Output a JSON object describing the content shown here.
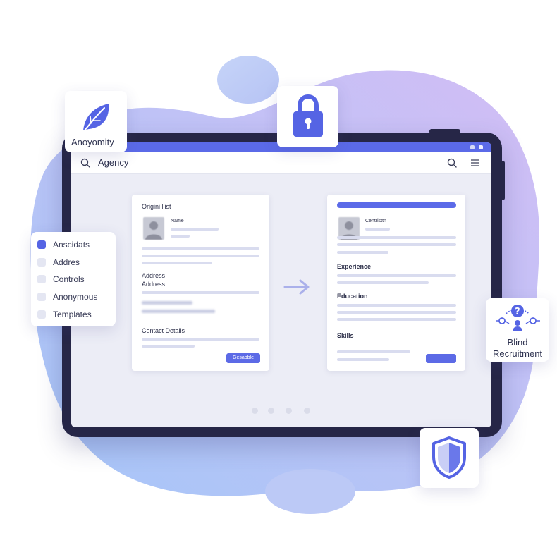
{
  "badges": {
    "anonymity_label": "Anoyomity",
    "blind_line1": "Blind",
    "blind_line2": "Recruitment"
  },
  "toolbar": {
    "title": "Agency"
  },
  "menu": {
    "items": [
      {
        "label": "Anscidats",
        "checked": true
      },
      {
        "label": "Addres",
        "checked": false
      },
      {
        "label": "Controls",
        "checked": false
      },
      {
        "label": "Anonymous",
        "checked": false
      },
      {
        "label": "Templates",
        "checked": false
      }
    ]
  },
  "original_card": {
    "title": "Origini llist",
    "name_label": "Name",
    "address_label_1": "Address",
    "address_label_2": "Address",
    "contact_label": "Contact Details",
    "button_label": "Gesabble"
  },
  "anon_card": {
    "candidate_label": "Centristtn",
    "experience_label": "Experience",
    "education_label": "Education",
    "skills_label": "Skills"
  },
  "icons": {
    "leaf": "leaf-icon",
    "lock": "lock-icon",
    "search": "search-icon",
    "menu": "hamburger-icon",
    "arrow": "arrow-right-icon",
    "network": "question-network-icon",
    "shield": "shield-icon"
  },
  "colors": {
    "accent": "#5b6ae8",
    "tablet_frame": "#262647",
    "blob_light": "#b9c9f6",
    "blob_purple": "#c8b8f4"
  }
}
